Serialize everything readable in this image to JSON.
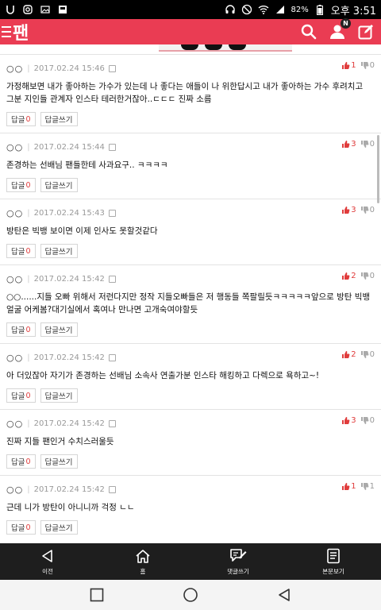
{
  "status_bar": {
    "battery": "82%",
    "time": "오후 3:51"
  },
  "header": {
    "logo": "팬",
    "notification_badge": "N"
  },
  "comments": [
    {
      "user": "○○",
      "date": "2017.02.24 15:46",
      "up": "1",
      "down": "0",
      "text": "가정해보면 내가 좋아하는 가수가 있는데 나 좋다는 애들이 나 위한답시고 내가 좋아하는 가수 후려치고 그분 지인들 관계자 인스타 테러한거잖아..ㄷㄷㄷ 진짜 소름",
      "reply_label": "답글",
      "reply_count": "0",
      "write_label": "답글쓰기"
    },
    {
      "user": "○○",
      "date": "2017.02.24 15:44",
      "up": "3",
      "down": "0",
      "text": "존경하는 선배님 팬들한테 사과요구.. ㅋㅋㅋㅋ",
      "reply_label": "답글",
      "reply_count": "0",
      "write_label": "답글쓰기"
    },
    {
      "user": "○○",
      "date": "2017.02.24 15:43",
      "up": "3",
      "down": "0",
      "text": "방탄은 빅뱅 보이면 이제 인사도 못할것같다",
      "reply_label": "답글",
      "reply_count": "0",
      "write_label": "답글쓰기"
    },
    {
      "user": "○○",
      "date": "2017.02.24 15:42",
      "up": "2",
      "down": "0",
      "text": "○○......지들 오빠 위해서 저런다지만 정작 지들오빠들은 저 행동들 쪽팔릴듯ㅋㅋㅋㅋㅋ앞으로 방탄 빅뱅얼굴 어케봄?대기실에서 혹여나 만나면 고개숙여야할듯",
      "reply_label": "답글",
      "reply_count": "0",
      "write_label": "답글쓰기"
    },
    {
      "user": "○○",
      "date": "2017.02.24 15:42",
      "up": "2",
      "down": "0",
      "text": "아 더있잖아 자기가 존경하는 선배님 소속사 연출가분 인스타 해킹하고 다렉으로 욕하고~!",
      "reply_label": "답글",
      "reply_count": "0",
      "write_label": "답글쓰기"
    },
    {
      "user": "○○",
      "date": "2017.02.24 15:42",
      "up": "3",
      "down": "0",
      "text": "진짜 지들 팬인거 수치스러울듯",
      "reply_label": "답글",
      "reply_count": "0",
      "write_label": "답글쓰기"
    },
    {
      "user": "○○",
      "date": "2017.02.24 15:42",
      "up": "1",
      "down": "1",
      "text": "근데 니가 방탄이 아니니까 걱정 ㄴㄴ",
      "reply_label": "답글",
      "reply_count": "0",
      "write_label": "답글쓰기"
    }
  ],
  "bottom_nav": {
    "items": [
      {
        "label": "이전",
        "icon": "back-icon"
      },
      {
        "label": "홈",
        "icon": "home-icon"
      },
      {
        "label": "댓글쓰기",
        "icon": "comment-write-icon"
      },
      {
        "label": "본문보기",
        "icon": "document-icon"
      }
    ]
  },
  "colors": {
    "brand": "#ea3c53",
    "upvote": "#e03c3c",
    "nav_bg": "#1e1e1e"
  }
}
